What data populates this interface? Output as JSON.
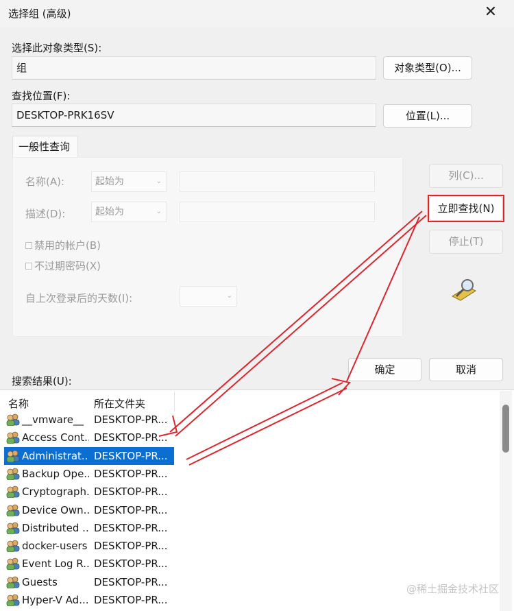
{
  "window": {
    "title": "选择组 (高级)"
  },
  "object_type": {
    "label": "选择此对象类型(S):",
    "value": "组",
    "button": "对象类型(O)..."
  },
  "location": {
    "label": "查找位置(F):",
    "value": "DESKTOP-PRK16SV",
    "button": "位置(L)..."
  },
  "query": {
    "tab_label": "一般性查询",
    "name_label": "名称(A):",
    "name_mode": "起始为",
    "desc_label": "描述(D):",
    "desc_mode": "起始为",
    "disabled_accounts": "禁用的帐户(B)",
    "non_expiring": "不过期密码(X)",
    "days_label": "自上次登录后的天数(I):"
  },
  "side_buttons": {
    "columns": "列(C)...",
    "find_now": "立即查找(N)",
    "stop": "停止(T)"
  },
  "ok": "确定",
  "cancel": "取消",
  "results": {
    "label": "搜索结果(U):",
    "headers": [
      "名称",
      "所在文件夹"
    ],
    "rows": [
      {
        "name": "__vmware__",
        "folder": "DESKTOP-PR..."
      },
      {
        "name": "Access Cont...",
        "folder": "DESKTOP-PR..."
      },
      {
        "name": "Administrat...",
        "folder": "DESKTOP-PR...",
        "selected": true
      },
      {
        "name": "Backup Ope...",
        "folder": "DESKTOP-PR..."
      },
      {
        "name": "Cryptograph...",
        "folder": "DESKTOP-PR..."
      },
      {
        "name": "Device Own...",
        "folder": "DESKTOP-PR..."
      },
      {
        "name": "Distributed ...",
        "folder": "DESKTOP-PR..."
      },
      {
        "name": "docker-users",
        "folder": "DESKTOP-PR..."
      },
      {
        "name": "Event Log R...",
        "folder": "DESKTOP-PR..."
      },
      {
        "name": "Guests",
        "folder": "DESKTOP-PR..."
      },
      {
        "name": "Hyper-V Ad...",
        "folder": "DESKTOP-PR..."
      }
    ]
  },
  "watermark": "@稀土掘金技术社区",
  "annotation_color": "#e0242b",
  "selection_color": "#0a6fd0"
}
